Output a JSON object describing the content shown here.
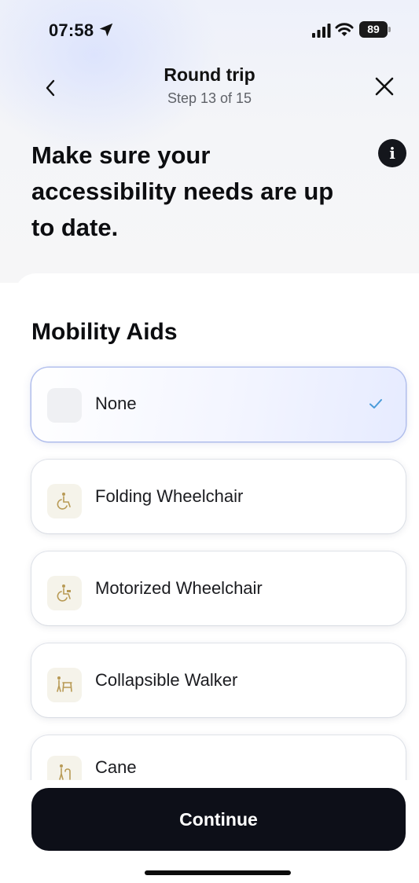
{
  "status_bar": {
    "time": "07:58",
    "battery": "89"
  },
  "nav": {
    "title": "Round trip",
    "subtitle": "Step 13 of 15"
  },
  "heading": "Make sure your accessibility needs are up to date.",
  "section": {
    "title": "Mobility Aids",
    "options": [
      {
        "label": "None",
        "icon": "empty-icon",
        "selected": true
      },
      {
        "label": "Folding Wheelchair",
        "icon": "wheelchair-icon",
        "selected": false
      },
      {
        "label": "Motorized Wheelchair",
        "icon": "motorized-wheelchair-icon",
        "selected": false
      },
      {
        "label": "Collapsible Walker",
        "icon": "walker-icon",
        "selected": false
      },
      {
        "label": "Cane",
        "icon": "cane-icon",
        "selected": false
      }
    ]
  },
  "continue_label": "Continue",
  "colors": {
    "accent_check": "#4a9bd9",
    "icon_tint": "#b89a55",
    "button_bg": "#0d0f18"
  }
}
